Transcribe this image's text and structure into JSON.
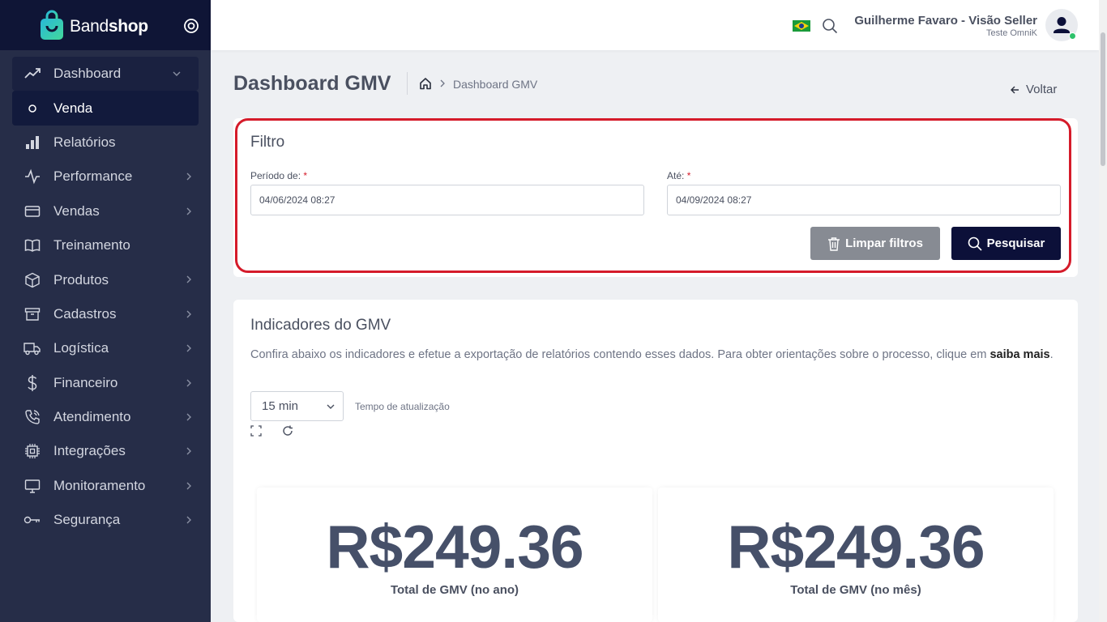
{
  "brand": {
    "name_light": "Band",
    "name_bold": "shop"
  },
  "sidebar": {
    "items": [
      {
        "label": "Dashboard",
        "icon": "trend-icon"
      },
      {
        "label": "Venda",
        "icon": "circle-icon"
      },
      {
        "label": "Relatórios",
        "icon": "bar-chart-icon"
      },
      {
        "label": "Performance",
        "icon": "pulse-icon"
      },
      {
        "label": "Vendas",
        "icon": "credit-card-icon"
      },
      {
        "label": "Treinamento",
        "icon": "book-icon"
      },
      {
        "label": "Produtos",
        "icon": "box-icon"
      },
      {
        "label": "Cadastros",
        "icon": "archive-icon"
      },
      {
        "label": "Logística",
        "icon": "truck-icon"
      },
      {
        "label": "Financeiro",
        "icon": "dollar-icon"
      },
      {
        "label": "Atendimento",
        "icon": "phone-icon"
      },
      {
        "label": "Integrações",
        "icon": "chip-icon"
      },
      {
        "label": "Monitoramento",
        "icon": "monitor-icon"
      },
      {
        "label": "Segurança",
        "icon": "key-icon"
      }
    ]
  },
  "topbar": {
    "user_name": "Guilherme Favaro - Visão Seller",
    "user_sub": "Teste OmniK"
  },
  "header": {
    "title": "Dashboard GMV",
    "breadcrumb": "Dashboard GMV",
    "back": "Voltar"
  },
  "filter": {
    "title": "Filtro",
    "from_label": "Período de:",
    "to_label": "Até:",
    "required_mark": "*",
    "from_value": "04/06/2024 08:27",
    "to_value": "04/09/2024 08:27",
    "clear_label": "Limpar filtros",
    "search_label": "Pesquisar"
  },
  "indicators": {
    "title": "Indicadores do GMV",
    "desc": "Confira abaixo os indicadores e efetue a exportação de relatórios contendo esses dados. Para obter orientações sobre o processo, clique em",
    "link": "saiba mais",
    "period": ".",
    "refresh_value": "15 min",
    "refresh_label": "Tempo de atualização",
    "kpis": [
      {
        "value": "R$249.36",
        "label": "Total de GMV (no ano)"
      },
      {
        "value": "R$249.36",
        "label": "Total de GMV (no mês)"
      }
    ]
  },
  "colors": {
    "sidebar": "#262d48",
    "primary": "#0c1039",
    "highlight": "#d51b2a",
    "online": "#2ec26b"
  }
}
